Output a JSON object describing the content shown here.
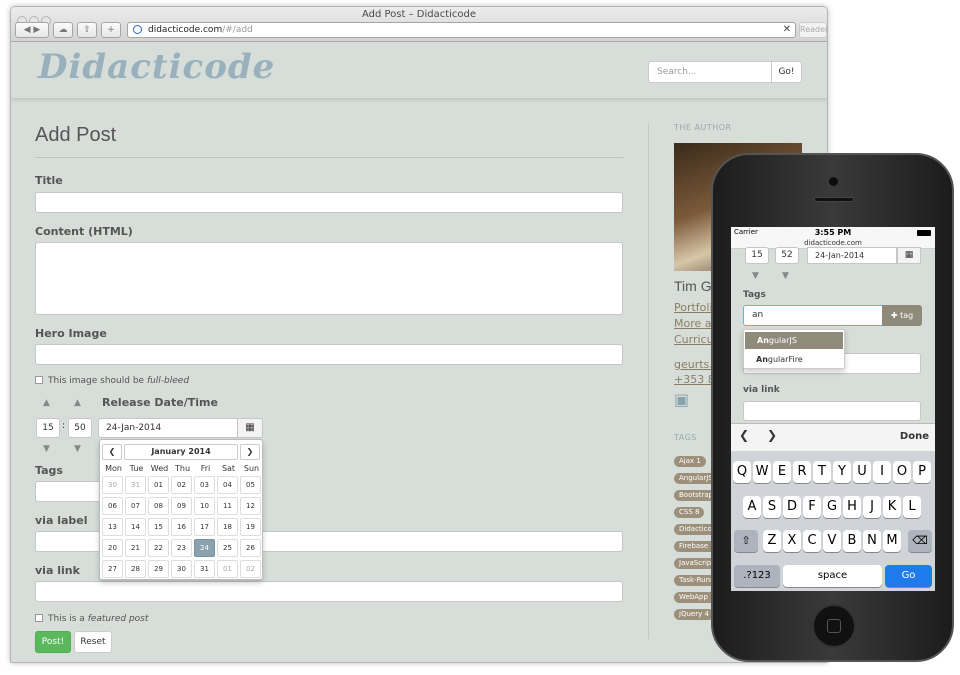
{
  "window": {
    "title": "Add Post – Didacticode",
    "url_host": "didacticode.com",
    "url_path": "/#/add",
    "reader": "Reader"
  },
  "site": {
    "logo": "Didacticode",
    "search_placeholder": "Search...",
    "go": "Go!"
  },
  "form": {
    "heading": "Add Post",
    "title_label": "Title",
    "content_label": "Content (HTML)",
    "hero_label": "Hero Image",
    "fullbleed_text": "This image should be ",
    "fullbleed_em": "full-bleed",
    "release_label": "Release Date/Time",
    "hour": "15",
    "minute": "50",
    "colon": ":",
    "date": "24-Jan-2014",
    "tags_label": "Tags",
    "via_label": "via label",
    "via_link": "via link",
    "featured_text": "This is a ",
    "featured_em": "featured post",
    "post_btn": "Post!",
    "reset_btn": "Reset"
  },
  "calendar": {
    "month": "January 2014",
    "prev": "❮",
    "next": "❯",
    "dow": [
      "Mon",
      "Tue",
      "Wed",
      "Thu",
      "Fri",
      "Sat",
      "Sun"
    ],
    "weeks": [
      [
        "30",
        "31",
        "01",
        "02",
        "03",
        "04",
        "05"
      ],
      [
        "06",
        "07",
        "08",
        "09",
        "10",
        "11",
        "12"
      ],
      [
        "13",
        "14",
        "15",
        "16",
        "17",
        "18",
        "19"
      ],
      [
        "20",
        "21",
        "22",
        "23",
        "24",
        "25",
        "26"
      ],
      [
        "27",
        "28",
        "29",
        "30",
        "31",
        "01",
        "02"
      ]
    ],
    "selected": "24"
  },
  "sidebar": {
    "author_heading": "THE AUTHOR",
    "name": "Tim G",
    "links": [
      "Portfoli",
      "More ab",
      "Curricu"
    ],
    "email": "geurts.ti",
    "phone": "+353 85",
    "tags_heading": "TAGS",
    "tags": [
      "Ajax 1",
      "AngularJS",
      "Bootstrap",
      "CSS 8",
      "Didacticode",
      "Firebase 1",
      "JavaScript",
      "Task-Runn",
      "WebApp 1",
      "jQuery 4"
    ]
  },
  "phone": {
    "carrier": "Carrier",
    "time": "3:55 PM",
    "host": "didacticode.com",
    "hour": "15",
    "minute": "52",
    "date": "24-Jan-2014",
    "tags_label": "Tags",
    "tag_input": "an",
    "tag_btn": "tag",
    "suggestions": [
      {
        "bold": "An",
        "rest": "gularJS"
      },
      {
        "bold": "An",
        "rest": "gularFire"
      }
    ],
    "via_link": "via link",
    "done": "Done",
    "row1": [
      "Q",
      "W",
      "E",
      "R",
      "T",
      "Y",
      "U",
      "I",
      "O",
      "P"
    ],
    "row2": [
      "A",
      "S",
      "D",
      "F",
      "G",
      "H",
      "J",
      "K",
      "L"
    ],
    "row3": [
      "Z",
      "X",
      "C",
      "V",
      "B",
      "N",
      "M"
    ],
    "num": ".?123",
    "space": "space",
    "go": "Go"
  }
}
